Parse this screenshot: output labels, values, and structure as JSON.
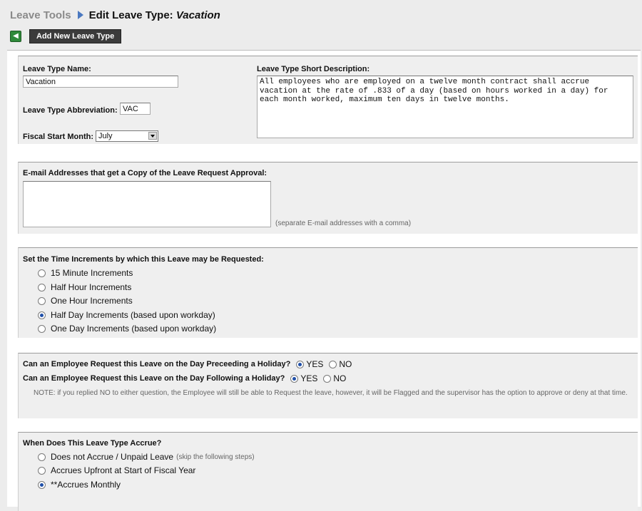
{
  "header": {
    "root": "Leave Tools",
    "title_prefix": "Edit Leave Type:",
    "title_name": "Vacation"
  },
  "toolbar": {
    "add_label": "Add New Leave Type"
  },
  "basic": {
    "name_label": "Leave Type Name:",
    "name_value": "Vacation",
    "abbr_label": "Leave Type Abbreviation:",
    "abbr_value": "VAC",
    "fiscal_label": "Fiscal Start Month:",
    "fiscal_value": "July",
    "desc_label": "Leave Type Short Description:",
    "desc_value": "All employees who are employed on a twelve month contract shall accrue vacation at the rate of .833 of a day (based on hours worked in a day) for each month worked, maximum ten days in twelve months."
  },
  "email": {
    "label": "E-mail Addresses that get a Copy of the Leave Request Approval:",
    "value": "",
    "hint": "(separate E-mail addresses with a comma)"
  },
  "increments": {
    "label": "Set the Time Increments by which this Leave may be Requested:",
    "options": [
      {
        "label": "15 Minute Increments",
        "selected": false
      },
      {
        "label": "Half Hour Increments",
        "selected": false
      },
      {
        "label": "One Hour Increments",
        "selected": false
      },
      {
        "label": "Half Day Increments (based upon workday)",
        "selected": true
      },
      {
        "label": "One Day Increments (based upon workday)",
        "selected": false
      }
    ]
  },
  "holiday": {
    "q1": "Can an Employee Request this Leave on the Day Preceeding a Holiday?",
    "q2": "Can an Employee Request this Leave on the Day Following a Holiday?",
    "yes": "YES",
    "no": "NO",
    "q1_answer": "YES",
    "q2_answer": "YES",
    "note": "NOTE: if you replied NO to either question, the Employee will still be able to Request the leave, however, it will be Flagged and the supervisor has the option to approve or deny at that time."
  },
  "accrue": {
    "label": "When Does This Leave Type Accrue?",
    "options": [
      {
        "label": "Does not Accrue / Unpaid Leave",
        "sub": "(skip the following steps)",
        "selected": false
      },
      {
        "label": "Accrues Upfront at Start of Fiscal Year",
        "sub": "",
        "selected": false
      },
      {
        "label": "**Accrues Monthly",
        "sub": "",
        "selected": true
      }
    ]
  },
  "colors": {
    "accent_blue": "#1f4fa8",
    "button_dark": "#3b3b3b",
    "back_green": "#2f8a3a"
  }
}
